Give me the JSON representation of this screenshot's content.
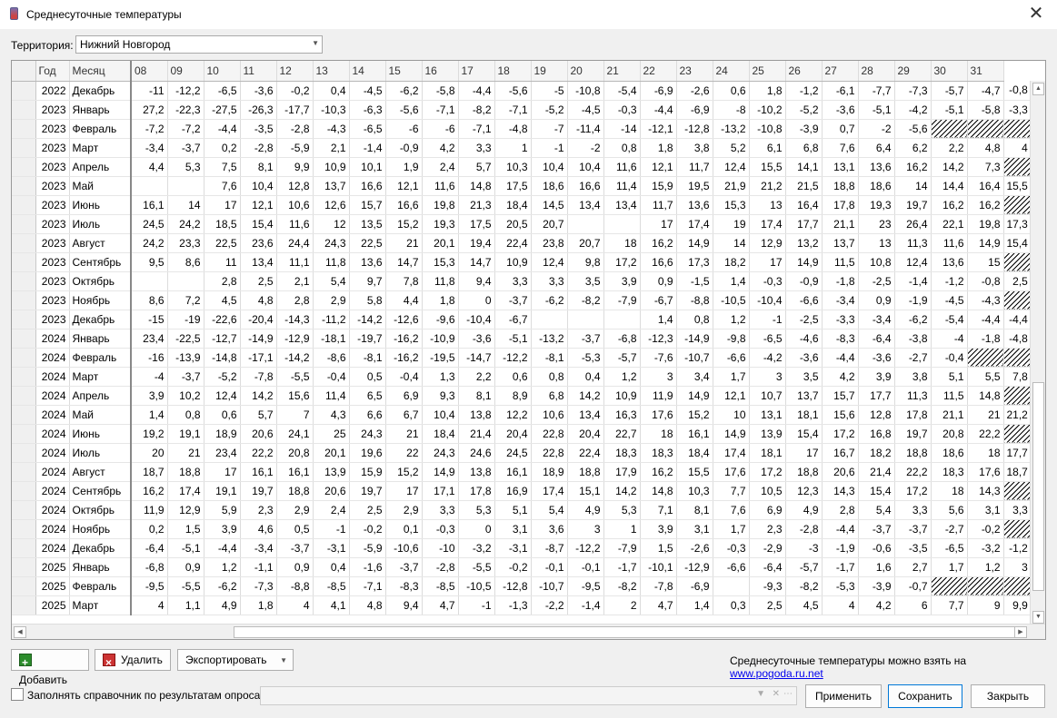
{
  "window": {
    "title": "Среднесуточные температуры"
  },
  "territory": {
    "label": "Территория:",
    "value": "Нижний Новгород"
  },
  "table": {
    "columns": [
      "Год",
      "Месяц",
      "08",
      "09",
      "10",
      "11",
      "12",
      "13",
      "14",
      "15",
      "16",
      "17",
      "18",
      "19",
      "20",
      "21",
      "22",
      "23",
      "24",
      "25",
      "26",
      "27",
      "28",
      "29",
      "30",
      "31"
    ],
    "rows": [
      [
        "2022",
        "Декабрь",
        "-11",
        "-12,2",
        "-6,5",
        "-3,6",
        "-0,2",
        "0,4",
        "-4,5",
        "-6,2",
        "-5,8",
        "-4,4",
        "-5,6",
        "-5",
        "-10,8",
        "-5,4",
        "-6,9",
        "-2,6",
        "0,6",
        "1,8",
        "-1,2",
        "-6,1",
        "-7,7",
        "-7,3",
        "-5,7",
        "-4,7",
        "-0,8"
      ],
      [
        "2023",
        "Январь",
        "27,2",
        "-22,3",
        "-27,5",
        "-26,3",
        "-17,7",
        "-10,3",
        "-6,3",
        "-5,6",
        "-7,1",
        "-8,2",
        "-7,1",
        "-5,2",
        "-4,5",
        "-0,3",
        "-4,4",
        "-6,9",
        "-8",
        "-10,2",
        "-5,2",
        "-3,6",
        "-5,1",
        "-4,2",
        "-5,1",
        "-5,8",
        "-3,3"
      ],
      [
        "2023",
        "Февраль",
        "-7,2",
        "-7,2",
        "-4,4",
        "-3,5",
        "-2,8",
        "-4,3",
        "-6,5",
        "-6",
        "-6",
        "-7,1",
        "-4,8",
        "-7",
        "-11,4",
        "-14",
        "-12,1",
        "-12,8",
        "-13,2",
        "-10,8",
        "-3,9",
        "0,7",
        "-2",
        "-5,6",
        "#",
        "#",
        "#"
      ],
      [
        "2023",
        "Март",
        "-3,4",
        "-3,7",
        "0,2",
        "-2,8",
        "-5,9",
        "2,1",
        "-1,4",
        "-0,9",
        "4,2",
        "3,3",
        "1",
        "-1",
        "-2",
        "0,8",
        "1,8",
        "3,8",
        "5,2",
        "6,1",
        "6,8",
        "7,6",
        "6,4",
        "6,2",
        "2,2",
        "4,8",
        "4"
      ],
      [
        "2023",
        "Апрель",
        "4,4",
        "5,3",
        "7,5",
        "8,1",
        "9,9",
        "10,9",
        "10,1",
        "1,9",
        "2,4",
        "5,7",
        "10,3",
        "10,4",
        "10,4",
        "11,6",
        "12,1",
        "11,7",
        "12,4",
        "15,5",
        "14,1",
        "13,1",
        "13,6",
        "16,2",
        "14,2",
        "7,3",
        "#"
      ],
      [
        "2023",
        "Май",
        "",
        "",
        "7,6",
        "10,4",
        "12,8",
        "13,7",
        "16,6",
        "12,1",
        "11,6",
        "14,8",
        "17,5",
        "18,6",
        "16,6",
        "11,4",
        "15,9",
        "19,5",
        "21,9",
        "21,2",
        "21,5",
        "18,8",
        "18,6",
        "14",
        "14,4",
        "16,4",
        "15,5"
      ],
      [
        "2023",
        "Июнь",
        "16,1",
        "14",
        "17",
        "12,1",
        "10,6",
        "12,6",
        "15,7",
        "16,6",
        "19,8",
        "21,3",
        "18,4",
        "14,5",
        "13,4",
        "13,4",
        "11,7",
        "13,6",
        "15,3",
        "13",
        "16,4",
        "17,8",
        "19,3",
        "19,7",
        "16,2",
        "16,2",
        "#"
      ],
      [
        "2023",
        "Июль",
        "24,5",
        "24,2",
        "18,5",
        "15,4",
        "11,6",
        "12",
        "13,5",
        "15,2",
        "19,3",
        "17,5",
        "20,5",
        "20,7",
        "",
        "",
        "17",
        "17,4",
        "19",
        "17,4",
        "17,7",
        "21,1",
        "23",
        "26,4",
        "22,1",
        "19,8",
        "17,3"
      ],
      [
        "2023",
        "Август",
        "24,2",
        "23,3",
        "22,5",
        "23,6",
        "24,4",
        "24,3",
        "22,5",
        "21",
        "20,1",
        "19,4",
        "22,4",
        "23,8",
        "20,7",
        "18",
        "16,2",
        "14,9",
        "14",
        "12,9",
        "13,2",
        "13,7",
        "13",
        "11,3",
        "11,6",
        "14,9",
        "15,4"
      ],
      [
        "2023",
        "Сентябрь",
        "9,5",
        "8,6",
        "11",
        "13,4",
        "11,1",
        "11,8",
        "13,6",
        "14,7",
        "15,3",
        "14,7",
        "10,9",
        "12,4",
        "9,8",
        "17,2",
        "16,6",
        "17,3",
        "18,2",
        "17",
        "14,9",
        "11,5",
        "10,8",
        "12,4",
        "13,6",
        "15",
        "#"
      ],
      [
        "2023",
        "Октябрь",
        "",
        "",
        "2,8",
        "2,5",
        "2,1",
        "5,4",
        "9,7",
        "7,8",
        "11,8",
        "9,4",
        "3,3",
        "3,3",
        "3,5",
        "3,9",
        "0,9",
        "-1,5",
        "1,4",
        "-0,3",
        "-0,9",
        "-1,8",
        "-2,5",
        "-1,4",
        "-1,2",
        "-0,8",
        "2,5"
      ],
      [
        "2023",
        "Ноябрь",
        "8,6",
        "7,2",
        "4,5",
        "4,8",
        "2,8",
        "2,9",
        "5,8",
        "4,4",
        "1,8",
        "0",
        "-3,7",
        "-6,2",
        "-8,2",
        "-7,9",
        "-6,7",
        "-8,8",
        "-10,5",
        "-10,4",
        "-6,6",
        "-3,4",
        "0,9",
        "-1,9",
        "-4,5",
        "-4,3",
        "#"
      ],
      [
        "2023",
        "Декабрь",
        "-15",
        "-19",
        "-22,6",
        "-20,4",
        "-14,3",
        "-11,2",
        "-14,2",
        "-12,6",
        "-9,6",
        "-10,4",
        "-6,7",
        "",
        "",
        "",
        "1,4",
        "0,8",
        "1,2",
        "-1",
        "-2,5",
        "-3,3",
        "-3,4",
        "-6,2",
        "-5,4",
        "-4,4",
        "-4,4"
      ],
      [
        "2024",
        "Январь",
        "23,4",
        "-22,5",
        "-12,7",
        "-14,9",
        "-12,9",
        "-18,1",
        "-19,7",
        "-16,2",
        "-10,9",
        "-3,6",
        "-5,1",
        "-13,2",
        "-3,7",
        "-6,8",
        "-12,3",
        "-14,9",
        "-9,8",
        "-6,5",
        "-4,6",
        "-8,3",
        "-6,4",
        "-3,8",
        "-4",
        "-1,8",
        "-4,8"
      ],
      [
        "2024",
        "Февраль",
        "-16",
        "-13,9",
        "-14,8",
        "-17,1",
        "-14,2",
        "-8,6",
        "-8,1",
        "-16,2",
        "-19,5",
        "-14,7",
        "-12,2",
        "-8,1",
        "-5,3",
        "-5,7",
        "-7,6",
        "-10,7",
        "-6,6",
        "-4,2",
        "-3,6",
        "-4,4",
        "-3,6",
        "-2,7",
        "-0,4",
        "#",
        "#"
      ],
      [
        "2024",
        "Март",
        "-4",
        "-3,7",
        "-5,2",
        "-7,8",
        "-5,5",
        "-0,4",
        "0,5",
        "-0,4",
        "1,3",
        "2,2",
        "0,6",
        "0,8",
        "0,4",
        "1,2",
        "3",
        "3,4",
        "1,7",
        "3",
        "3,5",
        "4,2",
        "3,9",
        "3,8",
        "5,1",
        "5,5",
        "7,8"
      ],
      [
        "2024",
        "Апрель",
        "3,9",
        "10,2",
        "12,4",
        "14,2",
        "15,6",
        "11,4",
        "6,5",
        "6,9",
        "9,3",
        "8,1",
        "8,9",
        "6,8",
        "14,2",
        "10,9",
        "11,9",
        "14,9",
        "12,1",
        "10,7",
        "13,7",
        "15,7",
        "17,7",
        "11,3",
        "11,5",
        "14,8",
        "#"
      ],
      [
        "2024",
        "Май",
        "1,4",
        "0,8",
        "0,6",
        "5,7",
        "7",
        "4,3",
        "6,6",
        "6,7",
        "10,4",
        "13,8",
        "12,2",
        "10,6",
        "13,4",
        "16,3",
        "17,6",
        "15,2",
        "10",
        "13,1",
        "18,1",
        "15,6",
        "12,8",
        "17,8",
        "21,1",
        "21",
        "21,2"
      ],
      [
        "2024",
        "Июнь",
        "19,2",
        "19,1",
        "18,9",
        "20,6",
        "24,1",
        "25",
        "24,3",
        "21",
        "18,4",
        "21,4",
        "20,4",
        "22,8",
        "20,4",
        "22,7",
        "18",
        "16,1",
        "14,9",
        "13,9",
        "15,4",
        "17,2",
        "16,8",
        "19,7",
        "20,8",
        "22,2",
        "#"
      ],
      [
        "2024",
        "Июль",
        "20",
        "21",
        "23,4",
        "22,2",
        "20,8",
        "20,1",
        "19,6",
        "22",
        "24,3",
        "24,6",
        "24,5",
        "22,8",
        "22,4",
        "18,3",
        "18,3",
        "18,4",
        "17,4",
        "18,1",
        "17",
        "16,7",
        "18,2",
        "18,8",
        "18,6",
        "18",
        "17,7"
      ],
      [
        "2024",
        "Август",
        "18,7",
        "18,8",
        "17",
        "16,1",
        "16,1",
        "13,9",
        "15,9",
        "15,2",
        "14,9",
        "13,8",
        "16,1",
        "18,9",
        "18,8",
        "17,9",
        "16,2",
        "15,5",
        "17,6",
        "17,2",
        "18,8",
        "20,6",
        "21,4",
        "22,2",
        "18,3",
        "17,6",
        "18,7"
      ],
      [
        "2024",
        "Сентябрь",
        "16,2",
        "17,4",
        "19,1",
        "19,7",
        "18,8",
        "20,6",
        "19,7",
        "17",
        "17,1",
        "17,8",
        "16,9",
        "17,4",
        "15,1",
        "14,2",
        "14,8",
        "10,3",
        "7,7",
        "10,5",
        "12,3",
        "14,3",
        "15,4",
        "17,2",
        "18",
        "14,3",
        "#"
      ],
      [
        "2024",
        "Октябрь",
        "11,9",
        "12,9",
        "5,9",
        "2,3",
        "2,9",
        "2,4",
        "2,5",
        "2,9",
        "3,3",
        "5,3",
        "5,1",
        "5,4",
        "4,9",
        "5,3",
        "7,1",
        "8,1",
        "7,6",
        "6,9",
        "4,9",
        "2,8",
        "5,4",
        "3,3",
        "5,6",
        "3,1",
        "3,3"
      ],
      [
        "2024",
        "Ноябрь",
        "0,2",
        "1,5",
        "3,9",
        "4,6",
        "0,5",
        "-1",
        "-0,2",
        "0,1",
        "-0,3",
        "0",
        "3,1",
        "3,6",
        "3",
        "1",
        "3,9",
        "3,1",
        "1,7",
        "2,3",
        "-2,8",
        "-4,4",
        "-3,7",
        "-3,7",
        "-2,7",
        "-0,2",
        "#"
      ],
      [
        "2024",
        "Декабрь",
        "-6,4",
        "-5,1",
        "-4,4",
        "-3,4",
        "-3,7",
        "-3,1",
        "-5,9",
        "-10,6",
        "-10",
        "-3,2",
        "-3,1",
        "-8,7",
        "-12,2",
        "-7,9",
        "1,5",
        "-2,6",
        "-0,3",
        "-2,9",
        "-3",
        "-1,9",
        "-0,6",
        "-3,5",
        "-6,5",
        "-3,2",
        "-1,2"
      ],
      [
        "2025",
        "Январь",
        "-6,8",
        "0,9",
        "1,2",
        "-1,1",
        "0,9",
        "0,4",
        "-1,6",
        "-3,7",
        "-2,8",
        "-5,5",
        "-0,2",
        "-0,1",
        "-0,1",
        "-1,7",
        "-10,1",
        "-12,9",
        "-6,6",
        "-6,4",
        "-5,7",
        "-1,7",
        "1,6",
        "2,7",
        "1,7",
        "1,2",
        "3"
      ],
      [
        "2025",
        "Февраль",
        "-9,5",
        "-5,5",
        "-6,2",
        "-7,3",
        "-8,8",
        "-8,5",
        "-7,1",
        "-8,3",
        "-8,5",
        "-10,5",
        "-12,8",
        "-10,7",
        "-9,5",
        "-8,2",
        "-7,8",
        "-6,9",
        "",
        "-9,3",
        "-8,2",
        "-5,3",
        "-3,9",
        "-0,7",
        "#",
        "#",
        "#"
      ],
      [
        "2025",
        "Март",
        "4",
        "1,1",
        "4,9",
        "1,8",
        "4",
        "4,1",
        "4,8",
        "9,4",
        "4,7",
        "-1",
        "-1,3",
        "-2,2",
        "-1,4",
        "2",
        "4,7",
        "1,4",
        "0,3",
        "2,5",
        "4,5",
        "4",
        "4,2",
        "6",
        "7,7",
        "9",
        "9,9"
      ]
    ]
  },
  "buttons": {
    "add": "Добавить",
    "delete": "Удалить",
    "export": "Экспортировать",
    "apply": "Применить",
    "save": "Сохранить",
    "close": "Закрыть"
  },
  "hint": {
    "text": "Среднесуточные температуры можно взять на ",
    "link": "www.pogoda.ru.net"
  },
  "fill_option": {
    "label": "Заполнять справочник по результатам опроса:",
    "checked": false
  }
}
